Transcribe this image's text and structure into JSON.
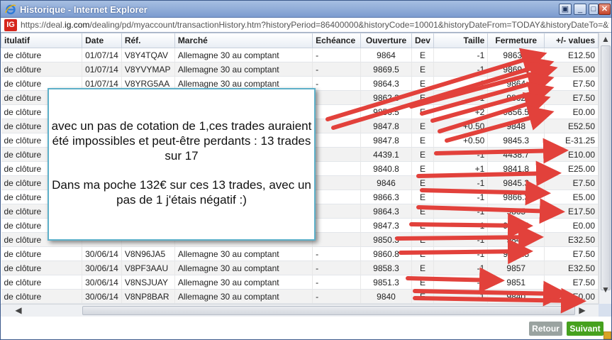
{
  "window": {
    "title": "Historique - Internet Explorer",
    "url_prefix": "https://deal.",
    "url_domain": "ig.com",
    "url_rest": "/dealing/pd/myaccount/transactionHistory.htm?historyPeriod=86400000&historyCode=10001&historyDateFrom=TODAY&historyDateTo=&transact",
    "logo": "IG"
  },
  "table": {
    "headers": [
      "itulatif",
      "Date",
      "Réf.",
      "Marché",
      "Echéance",
      "Ouverture",
      "Dev",
      "Taille",
      "Fermeture",
      "+/- values"
    ],
    "rows": [
      [
        "de clôture",
        "01/07/14",
        "V8Y4TQAV",
        "Allemagne 30 au comptant",
        "-",
        "9864",
        "E",
        "-1",
        "9863.5",
        "E12.50"
      ],
      [
        "de clôture",
        "01/07/14",
        "V8YVYMAP",
        "Allemagne 30 au comptant",
        "-",
        "9869.5",
        "E",
        "-1",
        "9869.3",
        "E5.00"
      ],
      [
        "de clôture",
        "01/07/14",
        "V8YRG5AA",
        "Allemagne 30 au comptant",
        "-",
        "9864.3",
        "E",
        "-1",
        "9864",
        "E7.50"
      ],
      [
        "de clôture",
        "",
        "",
        "",
        "",
        "9862.3",
        "E",
        "-1",
        "9862",
        "E7.50"
      ],
      [
        "de clôture",
        "",
        "",
        "",
        "",
        "9856.5",
        "E",
        "+2",
        "9856.5",
        "E0.00"
      ],
      [
        "de clôture",
        "",
        "",
        "",
        "",
        "9847.8",
        "E",
        "+0.50",
        "9848",
        "E52.50"
      ],
      [
        "de clôture",
        "",
        "",
        "",
        "",
        "9847.8",
        "E",
        "+0.50",
        "9845.3",
        "E-31.25"
      ],
      [
        "de clôture",
        "",
        "",
        "",
        "",
        "4439.1",
        "E",
        "-1",
        "4438.7",
        "E10.00"
      ],
      [
        "de clôture",
        "",
        "",
        "",
        "",
        "9840.8",
        "E",
        "+1",
        "9841.8",
        "E25.00"
      ],
      [
        "de clôture",
        "",
        "",
        "",
        "",
        "9846",
        "E",
        "-1",
        "9845.3",
        "E7.50"
      ],
      [
        "de clôture",
        "",
        "",
        "",
        "",
        "9866.3",
        "E",
        "-1",
        "9866.3",
        "E5.00"
      ],
      [
        "de clôture",
        "",
        "",
        "",
        "",
        "9864.3",
        "E",
        "-1",
        "9865",
        "E17.50"
      ],
      [
        "de clôture",
        "",
        "",
        "",
        "",
        "9847.3",
        "E",
        "-1",
        "9847.3",
        "E0.00"
      ],
      [
        "de clôture",
        "",
        "",
        "",
        "",
        "9850.3",
        "E",
        "-1",
        "9849",
        "E32.50"
      ],
      [
        "de clôture",
        "30/06/14",
        "V8N96JA5",
        "Allemagne 30 au comptant",
        "-",
        "9860.8",
        "E",
        "-1",
        "9860.5",
        "E7.50"
      ],
      [
        "de clôture",
        "30/06/14",
        "V8PF3AAU",
        "Allemagne 30 au comptant",
        "-",
        "9858.3",
        "E",
        "-1",
        "9857",
        "E32.50"
      ],
      [
        "de clôture",
        "30/06/14",
        "V8NSJUAY",
        "Allemagne 30 au comptant",
        "-",
        "9851.3",
        "E",
        "-1",
        "9851",
        "E7.50"
      ],
      [
        "de clôture",
        "30/06/14",
        "V8NP8BAR",
        "Allemagne 30 au comptant",
        "-",
        "9840",
        "E",
        "-1",
        "9840",
        "E0.00"
      ]
    ]
  },
  "annotation": {
    "line1": "avec un pas de cotation de 1,ces trades auraient été impossibles et peut-être perdants : 13 trades sur 17",
    "line2": "Dans ma poche 132€ sur ces 13 trades, avec un pas de 1 j'étais négatif :)"
  },
  "footer": {
    "back_label": "Retour",
    "next_label": "Suivant"
  },
  "colors": {
    "arrow": "#e2413b",
    "next_button": "#46a11e",
    "back_button": "#9aa3a0",
    "annotation_border": "#5eb0c9"
  }
}
